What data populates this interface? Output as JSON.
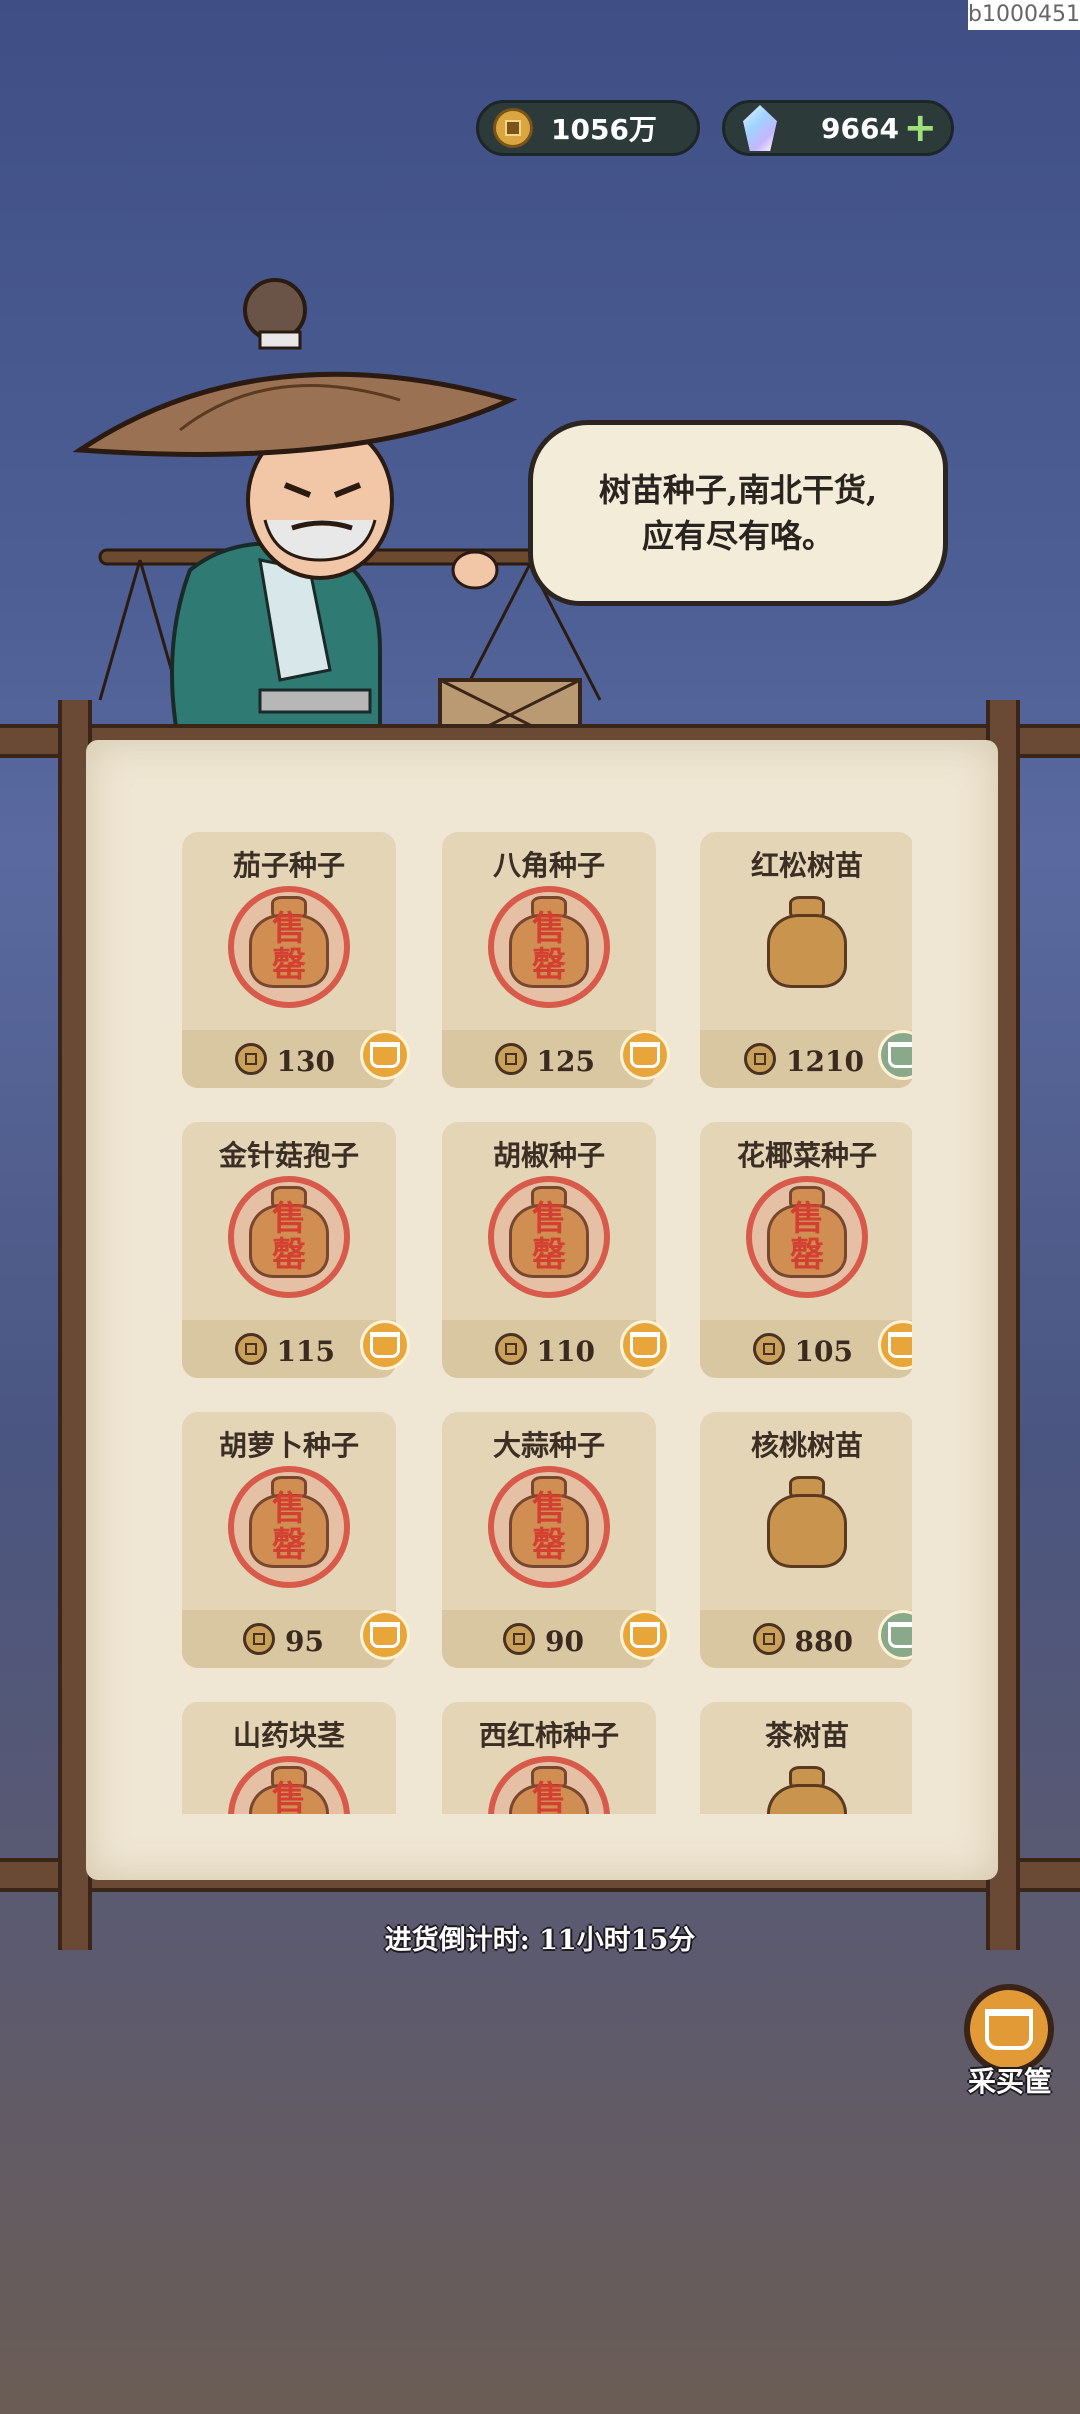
{
  "corner_id": "b1000451",
  "currency": {
    "coins": "1056万",
    "gems": "9664",
    "add_label": "+"
  },
  "merchant": {
    "speech_line1": "树苗种子,南北干货,",
    "speech_line2": "应有尽有咯。"
  },
  "stamp_text": "售罄",
  "items": [
    {
      "name": "茄子种子",
      "price": "130",
      "sold_out": true,
      "basket": "orange"
    },
    {
      "name": "八角种子",
      "price": "125",
      "sold_out": true,
      "basket": "orange"
    },
    {
      "name": "红松树苗",
      "price": "1210",
      "sold_out": false,
      "basket": "green"
    },
    {
      "name": "金针菇孢子",
      "price": "115",
      "sold_out": true,
      "basket": "orange"
    },
    {
      "name": "胡椒种子",
      "price": "110",
      "sold_out": true,
      "basket": "orange"
    },
    {
      "name": "花椰菜种子",
      "price": "105",
      "sold_out": true,
      "basket": "orange"
    },
    {
      "name": "胡萝卜种子",
      "price": "95",
      "sold_out": true,
      "basket": "orange"
    },
    {
      "name": "大蒜种子",
      "price": "90",
      "sold_out": true,
      "basket": "orange"
    },
    {
      "name": "核桃树苗",
      "price": "880",
      "sold_out": false,
      "basket": "green"
    },
    {
      "name": "山药块茎",
      "price": "",
      "sold_out": true,
      "basket": "orange"
    },
    {
      "name": "西红柿种子",
      "price": "",
      "sold_out": true,
      "basket": "orange"
    },
    {
      "name": "茶树苗",
      "price": "",
      "sold_out": false,
      "basket": "green"
    }
  ],
  "restock_timer": "进货倒计时: 11小时15分",
  "purchase_basket_label": "采买筐",
  "colors": {
    "paper": "#efe6d3",
    "card": "#e4d5b6",
    "stamp_red": "#d85a4a",
    "basket_orange": "#e8a53a",
    "basket_green": "#8aa88a"
  }
}
